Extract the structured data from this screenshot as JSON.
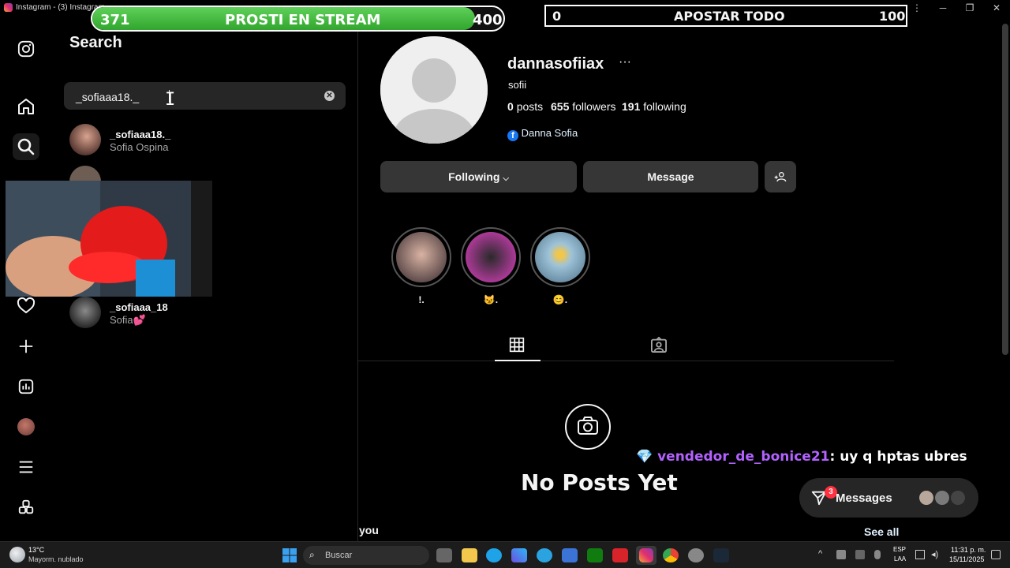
{
  "window": {
    "title": "Instagram - (3) Instagram"
  },
  "overlay": {
    "goal_start": "371",
    "goal_label": "PROSTI EN STREAM",
    "goal_end": "400",
    "goal_progress": 0.93,
    "bet_left": "0",
    "bet_label": "APOSTAR TODO",
    "bet_right": "100"
  },
  "nav": {
    "items": [
      {
        "icon": "instagram-logo-icon"
      },
      {
        "icon": "home-icon"
      },
      {
        "icon": "search-icon"
      },
      {
        "icon": "heart-icon"
      },
      {
        "icon": "create-plus-icon"
      },
      {
        "icon": "dashboard-icon"
      },
      {
        "icon": "profile-avatar"
      },
      {
        "icon": "menu-icon"
      },
      {
        "icon": "also-from-meta-icon"
      }
    ]
  },
  "search": {
    "title": "Search",
    "query": "_sofiaaa18._",
    "results": [
      {
        "username": "_sofiaaa18._",
        "name": "Sofia Ospina"
      },
      {
        "username": "_sofiaaa_18",
        "name": "Sofia💕"
      }
    ]
  },
  "profile": {
    "username": "dannasofiiax",
    "more": "···",
    "full_name": "sofii",
    "posts_count": "0",
    "posts_label": "posts",
    "followers_count": "655",
    "followers_label": "followers",
    "following_count": "191",
    "following_label": "following",
    "facebook_link": "Danna Sofia",
    "following_button": "Following",
    "message_button": "Message",
    "highlights": [
      {
        "label": "!."
      },
      {
        "label": "😼."
      },
      {
        "label": "😊."
      }
    ],
    "empty_title": "No Posts Yet"
  },
  "chat_overlay": {
    "user": "vendedor_de_bonice21",
    "message": ": uy q hptas ubres"
  },
  "bottom": {
    "you": "you",
    "see_all": "See all"
  },
  "messages": {
    "label": "Messages",
    "badge": "3"
  },
  "taskbar": {
    "weather_temp": "13°C",
    "weather_desc": "Mayorm. nublado",
    "search_placeholder": "Buscar",
    "lang": "ESP",
    "lang2": "LAA",
    "time": "11:31 p. m.",
    "date": "15/11/2025"
  }
}
